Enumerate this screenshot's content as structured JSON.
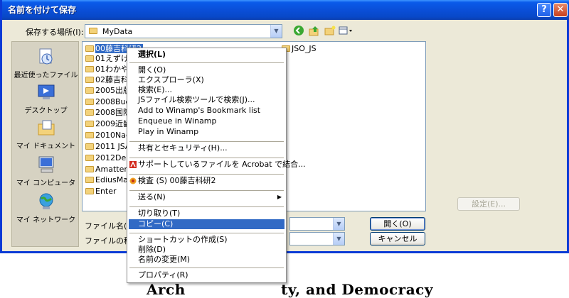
{
  "window": {
    "title": "名前を付けて保存"
  },
  "look_in": {
    "label": "保存する場所(I):",
    "value": "MyData"
  },
  "places": [
    {
      "label": "最近使ったファイル",
      "icon": "recent-documents-icon"
    },
    {
      "label": "デスクトップ",
      "icon": "desktop-icon"
    },
    {
      "label": "マイ ドキュメント",
      "icon": "my-documents-icon"
    },
    {
      "label": "マイ コンピュータ",
      "icon": "my-computer-icon"
    },
    {
      "label": "マイ ネットワーク",
      "icon": "my-network-icon"
    }
  ],
  "files": [
    "00藤吉科研2",
    "01えずけん",
    "01わかやま",
    "02藤吉科",
    "2005出版",
    "2008Buda",
    "2008国際",
    "2009近畿",
    "2010Nago",
    "2011 JSA",
    "2012Delh",
    "Amattero",
    "EdiusMan",
    "Enter"
  ],
  "files_col2": [
    "JSO_JS"
  ],
  "form": {
    "filename_label": "ファイル名(N):",
    "filetype_label": "ファイルの種類",
    "open_button": "開く(O)",
    "cancel_button": "キャンセル",
    "settings_button": "設定(E)..."
  },
  "context_menu": {
    "items": [
      {
        "label": "選択(L)",
        "bold": true
      },
      {
        "sep": true
      },
      {
        "label": "開く(O)"
      },
      {
        "label": "エクスプローラ(X)"
      },
      {
        "label": "検索(E)..."
      },
      {
        "label": "JSファイル検索ツールで検索(J)..."
      },
      {
        "label": "Add to Winamp's Bookmark list"
      },
      {
        "label": "Enqueue in Winamp"
      },
      {
        "label": "Play in Winamp"
      },
      {
        "sep": true
      },
      {
        "label": "共有とセキュリティ(H)..."
      },
      {
        "sep": true
      },
      {
        "label": "サポートしているファイルを Acrobat で結合...",
        "icon": "acrobat-icon"
      },
      {
        "sep": true
      },
      {
        "label": "検査 (S) 00藤吉科研2",
        "icon": "antivirus-icon"
      },
      {
        "sep": true
      },
      {
        "label": "送る(N)",
        "submenu": true
      },
      {
        "sep": true
      },
      {
        "label": "切り取り(T)"
      },
      {
        "label": "コピー(C)",
        "highlighted": true
      },
      {
        "sep": true
      },
      {
        "label": "ショートカットの作成(S)"
      },
      {
        "label": "削除(D)"
      },
      {
        "label": "名前の変更(M)"
      },
      {
        "sep": true
      },
      {
        "label": "プロパティ(R)"
      }
    ]
  },
  "caption": "Arch                  ty, and Democracy"
}
